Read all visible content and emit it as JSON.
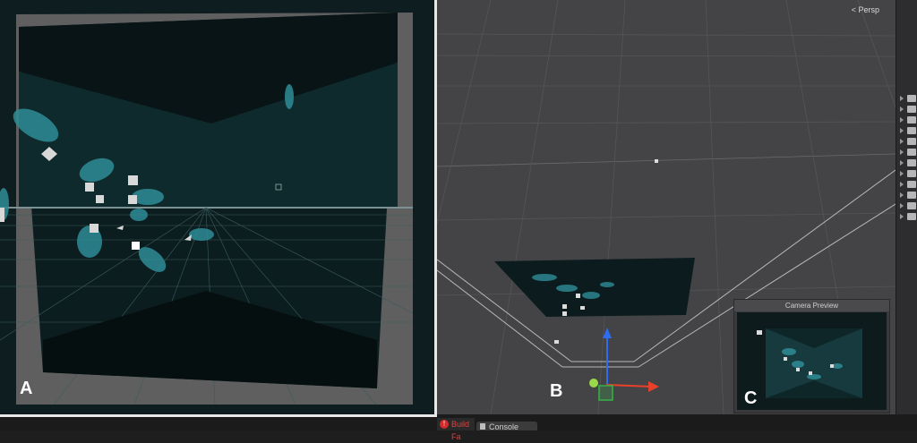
{
  "panels": {
    "a": {
      "letter": "A"
    },
    "b": {
      "letter": "B",
      "projection_label": "Persp"
    },
    "c": {
      "letter": "C",
      "title": "Camera Preview"
    }
  },
  "bottom_tabs": [
    {
      "label": "Build Fa",
      "status": "error"
    },
    {
      "label": "Console"
    }
  ],
  "colors": {
    "scene_bg": "#444446",
    "game_bg": "#0e1e20",
    "creature": "#2e8c96",
    "gizmo_y": "#2e6cf0",
    "gizmo_x": "#e8402a",
    "gizmo_z": "#37b54a"
  }
}
